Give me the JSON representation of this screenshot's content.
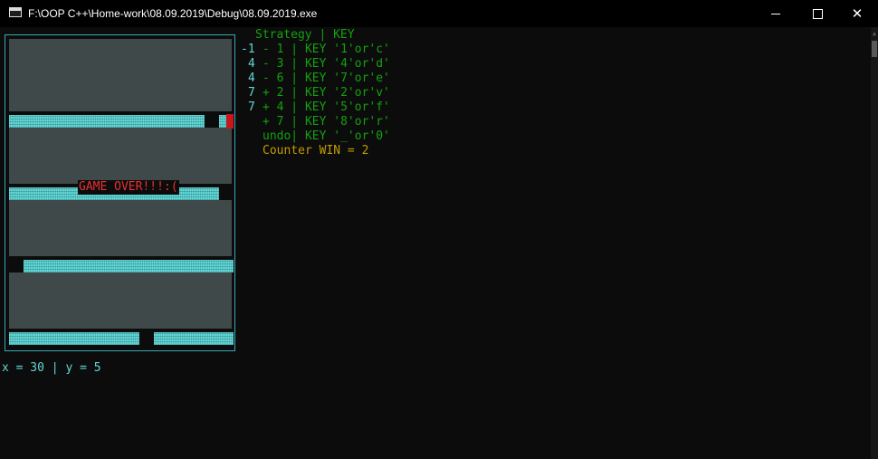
{
  "window": {
    "title": "F:\\OOP C++\\Home-work\\08.09.2019\\Debug\\08.09.2019.exe",
    "minimize_icon": "minimize-icon",
    "maximize_icon": "maximize-icon",
    "close_icon": "close-icon",
    "close_glyph": "✕"
  },
  "game": {
    "message": "GAME OVER!!!:("
  },
  "coords": {
    "text": "x = 30 | y = 5"
  },
  "strategy": {
    "header": "Strategy | KEY",
    "prefixes": [
      "-1",
      "4",
      "4",
      "7",
      "7"
    ],
    "rows": [
      "- 1 | KEY '1'or'c'",
      "- 3 | KEY '4'or'd'",
      "- 6 | KEY '7'or'e'",
      "+ 2 | KEY '2'or'v'",
      "+ 4 | KEY '5'or'f'",
      "+ 7 | KEY '8'or'r'",
      "undo| KEY '_'or'0'"
    ],
    "counter": "Counter WIN = 2"
  },
  "colors": {
    "background": "#0c0c0c",
    "strategy_text": "#13a10e",
    "prefix_text": "#61d6d6",
    "counter_text": "#c19c00",
    "game_over_text": "#e8302e",
    "board_border": "#3aa8b8",
    "player_block": "#c8161d",
    "row_fill": "#55cccc"
  }
}
